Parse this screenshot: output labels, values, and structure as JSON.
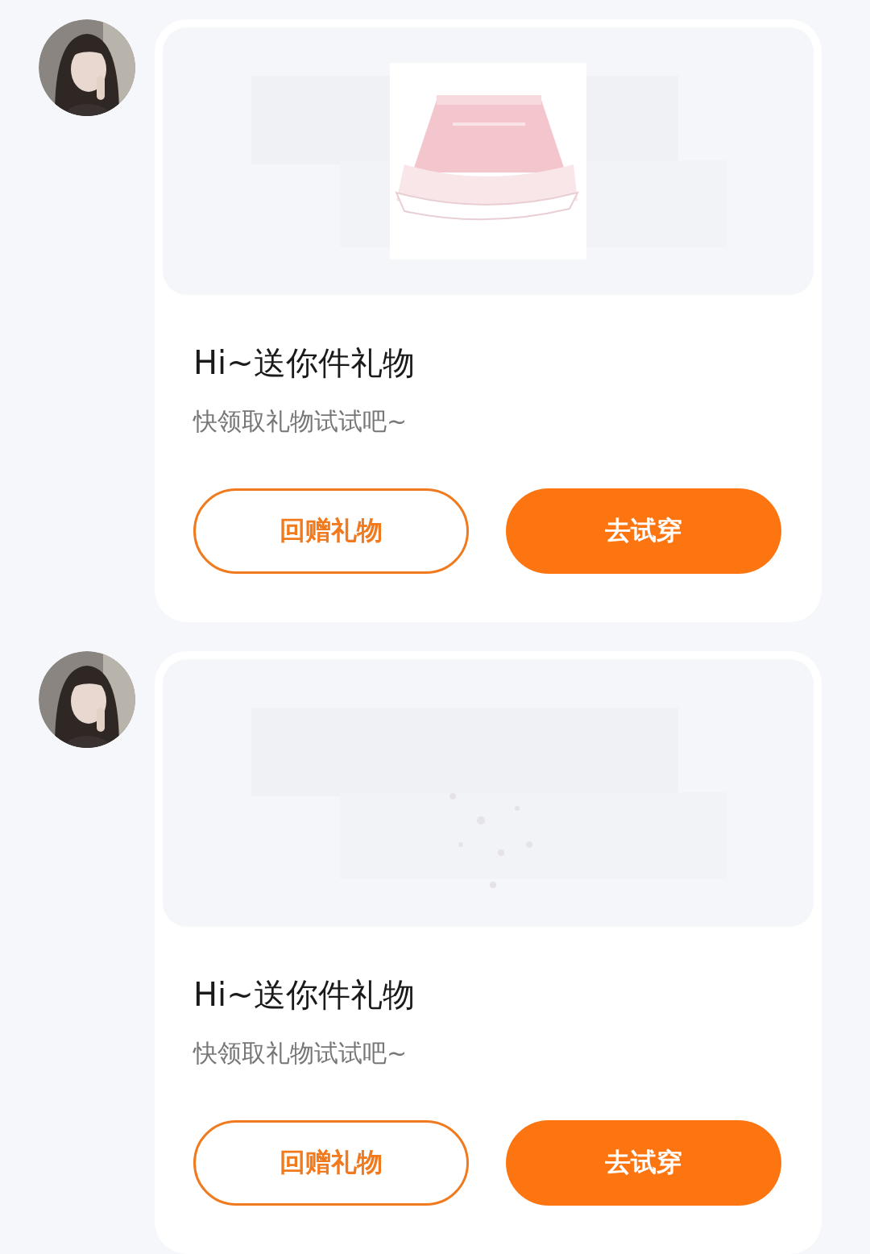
{
  "messages": [
    {
      "card": {
        "title": "Hi~送你件礼物",
        "subtitle": "快领取礼物试试吧~",
        "buttons": [
          {
            "label": "回赠礼物",
            "kind": "outline"
          },
          {
            "label": "去试穿",
            "kind": "primary"
          }
        ]
      }
    },
    {
      "card": {
        "title": "Hi~送你件礼物",
        "subtitle": "快领取礼物试试吧~",
        "buttons": [
          {
            "label": "回赠礼物",
            "kind": "outline"
          },
          {
            "label": "去试穿",
            "kind": "primary"
          }
        ]
      }
    }
  ]
}
